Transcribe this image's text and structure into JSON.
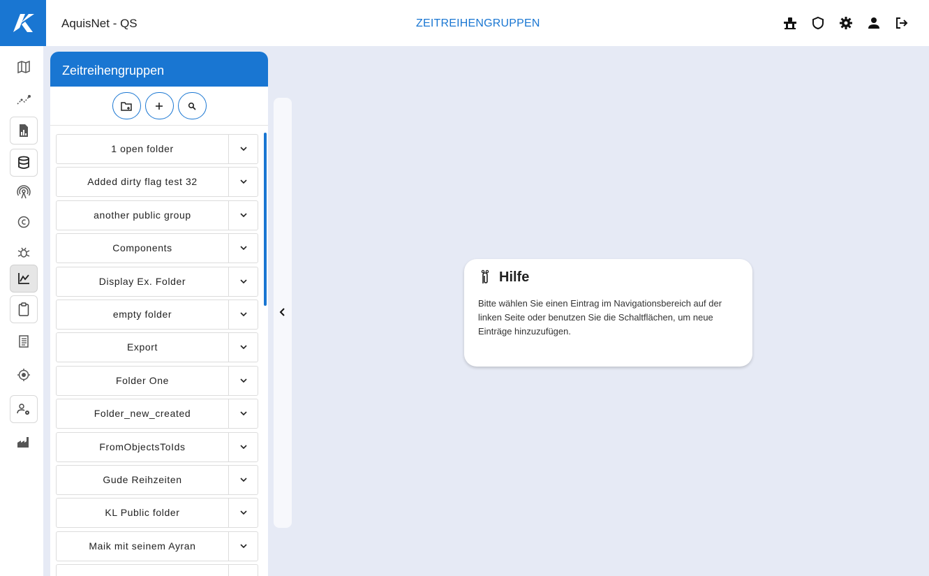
{
  "header": {
    "app_title": "AquisNet - QS",
    "page_title": "ZEITREIHENGRUPPEN",
    "icons": [
      "workshop-icon",
      "shield-icon",
      "settings-icon",
      "user-icon",
      "logout-icon"
    ]
  },
  "rail": {
    "items": [
      {
        "icon": "map-icon"
      },
      {
        "icon": "trend-icon"
      },
      {
        "icon": "report-icon"
      },
      {
        "icon": "database-icon"
      },
      {
        "icon": "sensor-icon"
      },
      {
        "icon": "copyright-icon"
      },
      {
        "icon": "bug-icon"
      },
      {
        "icon": "chart-icon",
        "active": true
      },
      {
        "icon": "clipboard-icon"
      },
      {
        "icon": "document-list-icon"
      },
      {
        "icon": "target-icon"
      },
      {
        "icon": "user-settings-icon"
      },
      {
        "icon": "factory-icon"
      }
    ]
  },
  "panel": {
    "title": "Zeitreihengruppen",
    "tools": [
      "new-folder-icon",
      "add-icon",
      "search-icon"
    ],
    "items": [
      "1 open folder",
      "Added dirty flag test 32",
      "another public group",
      "Components",
      "Display Ex. Folder",
      "empty folder",
      "Export",
      "Folder One",
      "Folder_new_created",
      "FromObjectsToIds",
      "Gude Reihzeiten",
      "KL Public folder",
      "Maik mit seinem Ayran",
      ""
    ]
  },
  "help": {
    "title": "Hilfe",
    "text": "Bitte wählen Sie einen Eintrag im Navigationsbereich auf der linken Seite oder benutzen Sie die Schaltflächen, um neue Einträge hinzuzufügen."
  },
  "colors": {
    "accent": "#1976d2",
    "background": "#e6eaf5"
  }
}
